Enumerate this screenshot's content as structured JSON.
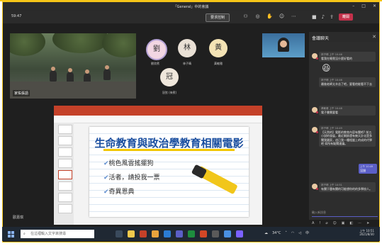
{
  "window": {
    "title": "「General」中的會議",
    "controls": [
      "–",
      "□",
      "✕"
    ]
  },
  "toolbar": {
    "timer": "59:47",
    "save_label": "要求控制",
    "icons": [
      "people-icon",
      "chat-icon",
      "raise-hand-icon",
      "reactions-icon",
      "more-icon",
      "camera-icon",
      "mic-icon",
      "share-icon"
    ],
    "leave_label": "離開"
  },
  "participants": {
    "video_main_name": "家佑張語",
    "avatars": [
      {
        "initial": "劉",
        "name": "劉欣賓",
        "color": "#f2d6e3"
      },
      {
        "initial": "林",
        "name": "林子晴",
        "color": "#e9e0d5"
      },
      {
        "initial": "黃",
        "name": "黃敏雅",
        "color": "#f4e3b5"
      },
      {
        "initial": "冠",
        "name": "冠弦 (來賓)",
        "color": "#efe7dc"
      }
    ]
  },
  "share": {
    "presenter": "歐嘉琪"
  },
  "slide": {
    "title": "生命教育與政治學教育相關電影",
    "bullets": [
      "桃色風雲搖擺狗",
      "活者，請投我一票",
      "奇異恩典"
    ]
  },
  "chat": {
    "header": "會議聊天",
    "messages": [
      {
        "author": "林子晴",
        "time": "上午 10:46",
        "body": "看我在睡覺沒什麼好看的"
      },
      {
        "author": "林子晴",
        "time": "上午 10:46",
        "body": "最後老師太辛苦了吧，要看他能看不下去"
      },
      {
        "author": "黃敏雅",
        "time": "上午 10:48",
        "body": "電子書需要看"
      },
      {
        "author": "林子晴",
        "time": "上午 10:49",
        "body": "【天然的】電影的教育內容有關吧? 前五小說的發展，最近剩餘還有幾天計化是多關我國家，這已我一種相當上的成的代學吧 如所有點關連議。"
      },
      {
        "author": "我",
        "time": "上午 10:49",
        "body": "沒錯"
      },
      {
        "author": "林子晴",
        "time": "上午 10:51",
        "body": "有關于題有關的可能想你的的多學校人。"
      }
    ],
    "input_placeholder": "輸入新訊息"
  },
  "taskbar": {
    "search_placeholder": "在這裡輸入文字來搜尋",
    "weather": "34°C",
    "time": "上午 10:51",
    "date": "2021/8/30"
  }
}
